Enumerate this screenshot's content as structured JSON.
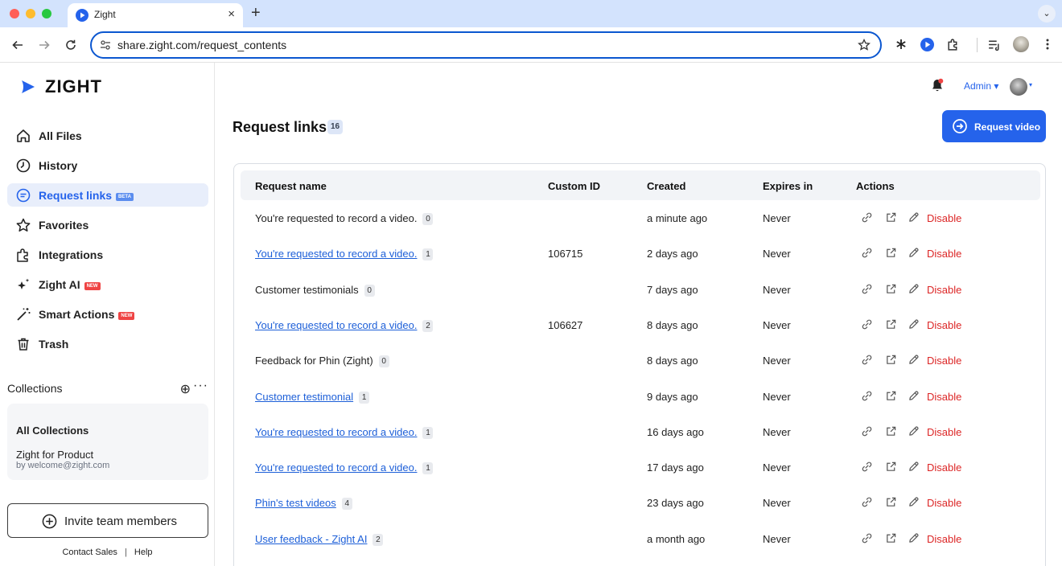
{
  "browser": {
    "tab_title": "Zight",
    "tab_close": "×",
    "new_tab": "+",
    "tab_menu": "⌄",
    "url_host": "share.zight.com",
    "url_path": "/request_contents"
  },
  "brand": {
    "name": "ZIGHT",
    "accent": "#2563eb",
    "danger": "#dc2626"
  },
  "sidebar": {
    "items": [
      {
        "label": "All Files",
        "icon": "home-icon",
        "badge": ""
      },
      {
        "label": "History",
        "icon": "clock-icon",
        "badge": ""
      },
      {
        "label": "Request links",
        "icon": "request-icon",
        "badge": "BETA"
      },
      {
        "label": "Favorites",
        "icon": "star-icon",
        "badge": ""
      },
      {
        "label": "Integrations",
        "icon": "puzzle-icon",
        "badge": ""
      },
      {
        "label": "Zight AI",
        "icon": "sparkle-icon",
        "badge": "NEW"
      },
      {
        "label": "Smart Actions",
        "icon": "magic-wand-icon",
        "badge": "NEW"
      },
      {
        "label": "Trash",
        "icon": "trash-icon",
        "badge": ""
      }
    ],
    "collections_title": "Collections",
    "collections_add": "⊕",
    "collections_more": "···",
    "all_collections": "All Collections",
    "collection_name": "Zight for Product",
    "collection_owner": "by welcome@zight.com",
    "invite_label": "Invite team members",
    "contact_sales": "Contact Sales",
    "separator": "|",
    "help": "Help"
  },
  "header": {
    "admin_label": "Admin ▾",
    "avatar_caret": "▾",
    "page_title": "Request links",
    "count": "16",
    "request_button": "Request video"
  },
  "table": {
    "columns": [
      "Request name",
      "Custom ID",
      "Created",
      "Expires in",
      "Actions"
    ],
    "disable_label": "Disable",
    "rows": [
      {
        "name": "You're requested to record a video.",
        "link": false,
        "count": "0",
        "custom_id": "",
        "created": "a minute ago",
        "expires": "Never"
      },
      {
        "name": "You're requested to record a video.",
        "link": true,
        "count": "1",
        "custom_id": "106715",
        "created": "2 days ago",
        "expires": "Never"
      },
      {
        "name": "Customer testimonials",
        "link": false,
        "count": "0",
        "custom_id": "",
        "created": "7 days ago",
        "expires": "Never"
      },
      {
        "name": "You're requested to record a video.",
        "link": true,
        "count": "2",
        "custom_id": "106627",
        "created": "8 days ago",
        "expires": "Never"
      },
      {
        "name": "Feedback for Phin (Zight)",
        "link": false,
        "count": "0",
        "custom_id": "",
        "created": "8 days ago",
        "expires": "Never"
      },
      {
        "name": "Customer testimonial",
        "link": true,
        "count": "1",
        "custom_id": "",
        "created": "9 days ago",
        "expires": "Never"
      },
      {
        "name": "You're requested to record a video.",
        "link": true,
        "count": "1",
        "custom_id": "",
        "created": "16 days ago",
        "expires": "Never"
      },
      {
        "name": "You're requested to record a video.",
        "link": true,
        "count": "1",
        "custom_id": "",
        "created": "17 days ago",
        "expires": "Never"
      },
      {
        "name": "Phin's test videos",
        "link": true,
        "count": "4",
        "custom_id": "",
        "created": "23 days ago",
        "expires": "Never"
      },
      {
        "name": "User feedback - Zight AI",
        "link": true,
        "count": "2",
        "custom_id": "",
        "created": "a month ago",
        "expires": "Never"
      }
    ]
  }
}
